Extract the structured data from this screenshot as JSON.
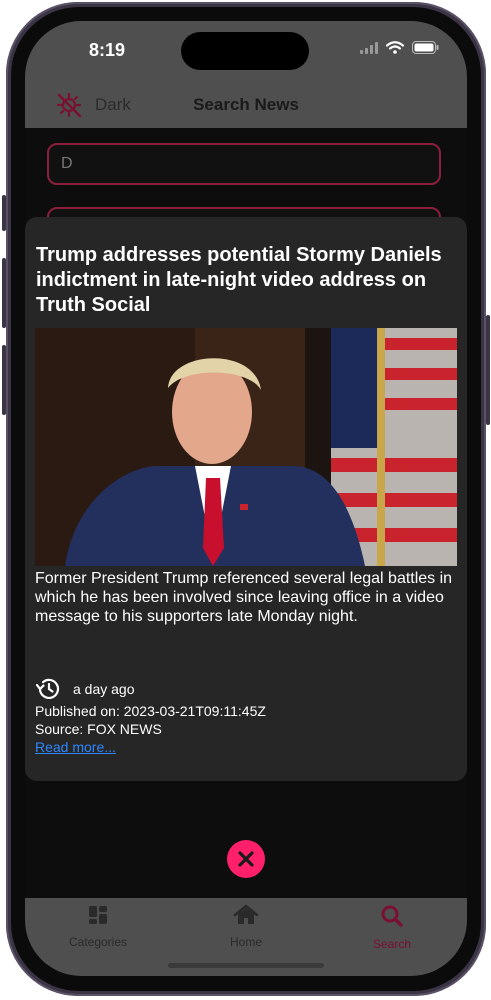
{
  "status_bar": {
    "time": "8:19"
  },
  "nav": {
    "theme_label": "Dark",
    "title": "Search News"
  },
  "search": {
    "value": "D"
  },
  "article": {
    "title": "Trump addresses potential Stormy Daniels indictment in late-night video address on Truth Social",
    "description": "Former President Trump referenced several legal battles in which he has been involved since leaving office in a video message to his supporters late Monday night.",
    "time_ago": "a day ago",
    "published": "Published on: 2023-03-21T09:11:45Z",
    "source": "Source: FOX NEWS",
    "read_more": "Read more..."
  },
  "tabs": [
    {
      "label": "Categories",
      "icon": "categories-icon",
      "active": false
    },
    {
      "label": "Home",
      "icon": "home-icon",
      "active": false
    },
    {
      "label": "Search",
      "icon": "search-icon",
      "active": true
    }
  ],
  "colors": {
    "accent": "#ff1f6b",
    "active_tab": "#7a1030",
    "link": "#2d88ff"
  }
}
